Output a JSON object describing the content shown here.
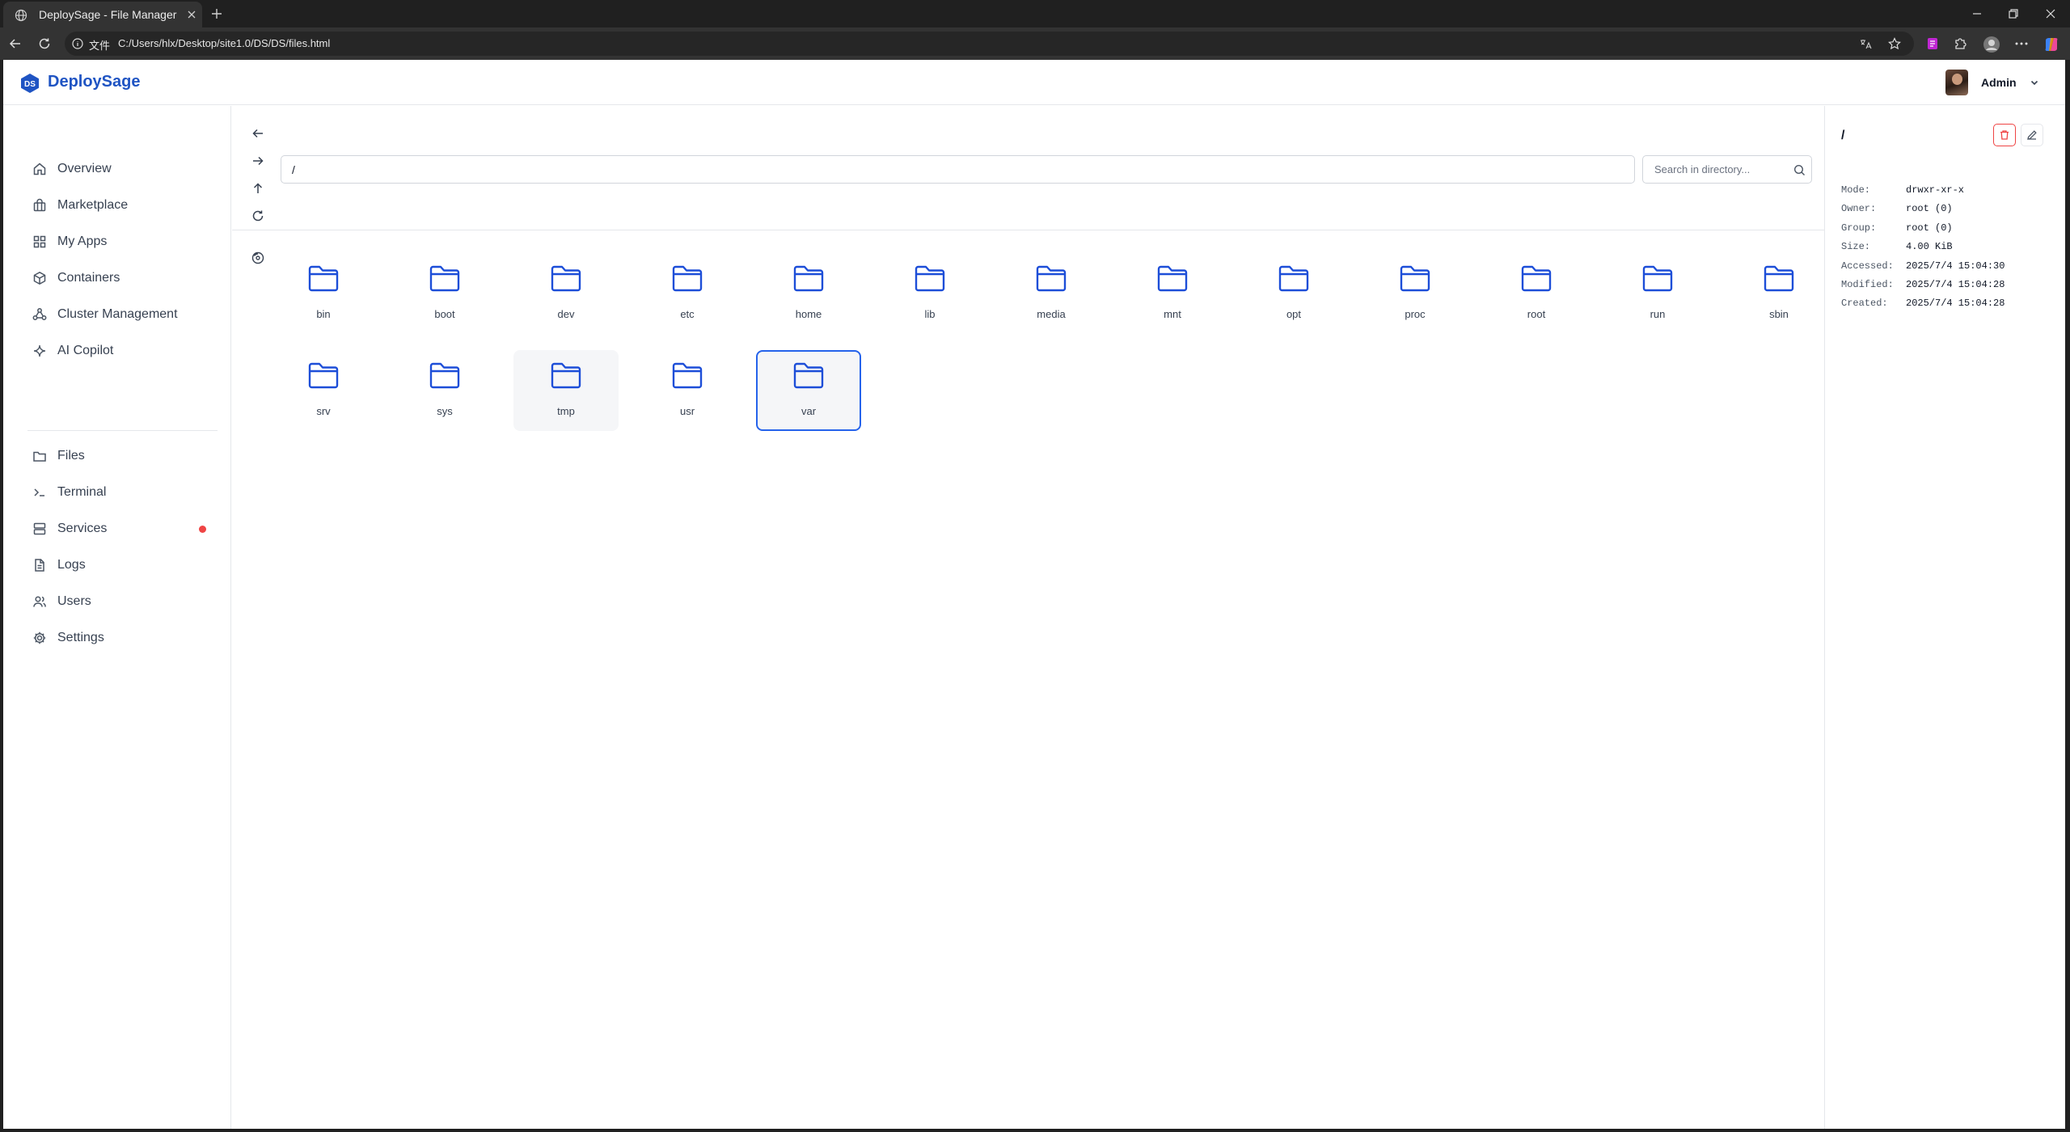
{
  "browser": {
    "tab_title": "DeploySage - File Manager",
    "scheme_label": "文件",
    "url": "C:/Users/hlx/Desktop/site1.0/DS/DS/files.html"
  },
  "app": {
    "logo_initials": "DS",
    "brand_name": "DeploySage",
    "accent_color": "#1f54c3",
    "user_name": "Admin"
  },
  "sidebar": {
    "primary": [
      {
        "label": "Overview",
        "icon": "home-icon"
      },
      {
        "label": "Marketplace",
        "icon": "shopping-bag-icon"
      },
      {
        "label": "My Apps",
        "icon": "grid-icon"
      },
      {
        "label": "Containers",
        "icon": "box-icon"
      },
      {
        "label": "Cluster Management",
        "icon": "network-icon"
      },
      {
        "label": "AI Copilot",
        "icon": "sparkle-icon"
      }
    ],
    "secondary": [
      {
        "label": "Files",
        "icon": "folder-icon",
        "active": true
      },
      {
        "label": "Terminal",
        "icon": "terminal-icon"
      },
      {
        "label": "Services",
        "icon": "server-icon",
        "alert": true,
        "alert_color": "#ef4444"
      },
      {
        "label": "Logs",
        "icon": "file-text-icon"
      },
      {
        "label": "Users",
        "icon": "users-icon"
      },
      {
        "label": "Settings",
        "icon": "gear-icon"
      }
    ]
  },
  "file_manager": {
    "path": "/",
    "search_placeholder": "Search in directory...",
    "folders": [
      {
        "name": "bin"
      },
      {
        "name": "boot"
      },
      {
        "name": "dev"
      },
      {
        "name": "etc"
      },
      {
        "name": "home"
      },
      {
        "name": "lib"
      },
      {
        "name": "media"
      },
      {
        "name": "mnt"
      },
      {
        "name": "opt"
      },
      {
        "name": "proc"
      },
      {
        "name": "root"
      },
      {
        "name": "run"
      },
      {
        "name": "sbin"
      },
      {
        "name": "srv"
      },
      {
        "name": "sys"
      },
      {
        "name": "tmp",
        "state": "hover"
      },
      {
        "name": "usr"
      },
      {
        "name": "var",
        "state": "selected"
      }
    ],
    "folder_color": "#1d4ed8"
  },
  "details": {
    "title": "/",
    "properties": [
      {
        "key": "Mode:",
        "value": "drwxr-xr-x"
      },
      {
        "key": "Owner:",
        "value": "root (0)"
      },
      {
        "key": "Group:",
        "value": "root (0)"
      },
      {
        "key": "Size:",
        "value": "4.00 KiB"
      },
      {
        "key": "Accessed:",
        "value": "2025/7/4 15:04:30"
      },
      {
        "key": "Modified:",
        "value": "2025/7/4 15:04:28"
      },
      {
        "key": "Created:",
        "value": "2025/7/4 15:04:28"
      }
    ]
  }
}
